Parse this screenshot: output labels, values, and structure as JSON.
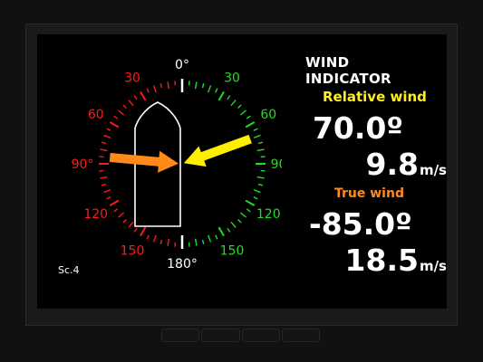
{
  "display": {
    "title": "WIND INDICATOR",
    "relative_wind": {
      "label": "Relative wind",
      "angle": "70.0º",
      "speed": "9.8",
      "speed_unit": "m/s",
      "direction_deg": 70
    },
    "true_wind": {
      "label": "True wind",
      "angle": "-85.0º",
      "speed": "18.5",
      "speed_unit": "m/s",
      "direction_deg": -85
    },
    "screen_label": "Sc.4"
  },
  "dial": {
    "labels": [
      {
        "deg": 0,
        "text": "0°"
      },
      {
        "deg": 30,
        "text": "30"
      },
      {
        "deg": 60,
        "text": "60"
      },
      {
        "deg": 90,
        "text": "90°"
      },
      {
        "deg": 120,
        "text": "120"
      },
      {
        "deg": 150,
        "text": "150"
      },
      {
        "deg": 180,
        "text": "180°"
      },
      {
        "deg": -150,
        "text": "150"
      },
      {
        "deg": -120,
        "text": "120"
      },
      {
        "deg": -90,
        "text": "90°"
      },
      {
        "deg": -60,
        "text": "60"
      },
      {
        "deg": -30,
        "text": "30"
      }
    ]
  },
  "colors": {
    "port": "#ff1a1a",
    "starboard": "#22dd22",
    "neutral": "#ffffff",
    "relative_arrow": "#ffee00",
    "true_arrow": "#ff8a1a"
  }
}
